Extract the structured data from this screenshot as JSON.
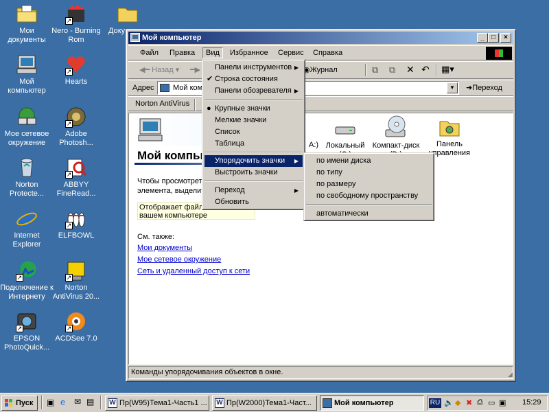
{
  "desktop": {
    "icons": [
      {
        "label": "Мои документы",
        "icon": "folder-documents-icon"
      },
      {
        "label": "Nero - Burning Rom",
        "icon": "nero-icon"
      },
      {
        "label": "Доку",
        "icon": "folder-icon"
      },
      {
        "label": "Мой компьютер",
        "icon": "my-computer-icon"
      },
      {
        "label": "Hearts",
        "icon": "hearts-icon"
      },
      {
        "label": "Мое сетевое окружение",
        "icon": "network-icon"
      },
      {
        "label": "Adobe Photosh...",
        "icon": "photoshop-icon"
      },
      {
        "label": "Norton Protecte...",
        "icon": "recycle-bin-icon"
      },
      {
        "label": "ABBYY FineRead...",
        "icon": "finereader-icon"
      },
      {
        "label": "Internet Explorer",
        "icon": "ie-icon"
      },
      {
        "label": "ELFBOWL",
        "icon": "elfbowl-icon"
      },
      {
        "label": "Подключение к Интернету",
        "icon": "connect-internet-icon"
      },
      {
        "label": "Norton AntiVirus 20...",
        "icon": "norton-icon"
      },
      {
        "label": "EPSON PhotoQuick...",
        "icon": "epson-icon"
      },
      {
        "label": "ACDSee 7.0",
        "icon": "acdsee-icon"
      }
    ]
  },
  "window": {
    "title": "Мой компьютер",
    "buttons": {
      "minimize": "_",
      "maximize": "□",
      "close": "×"
    },
    "menubar": [
      "Файл",
      "Правка",
      "Вид",
      "Избранное",
      "Сервис",
      "Справка"
    ],
    "toolbar": {
      "back": "Назад",
      "journal": "Журнал"
    },
    "address": {
      "label": "Адрес",
      "value": "Мой компьютер",
      "go": "Переход"
    },
    "links": {
      "norton": "Norton AntiVirus"
    },
    "content": {
      "heading": "Мой компьютер",
      "text1": "Чтобы просмотреть содержимое",
      "text2": "элемента, выделите его",
      "info1": "Отображает файлы и папки на",
      "info2": "вашем компьютере",
      "see_also": "См. также:",
      "links": [
        "Мои документы",
        "Мое сетевое окружение",
        "Сеть и удаленный доступ к сети"
      ],
      "drives": [
        {
          "label": "A:)",
          "icon": "floppy-icon"
        },
        {
          "label": "Локальный (C:)",
          "icon": "hard-drive-icon"
        },
        {
          "label": "Компакт-диск (D:)",
          "icon": "cd-drive-icon"
        },
        {
          "label": "Панель управления",
          "icon": "control-panel-icon"
        }
      ]
    },
    "status": "Команды упорядочивания объектов в окне."
  },
  "view_menu": {
    "items": [
      "Панели инструментов",
      "Строка состояния",
      "Панели обозревателя",
      "Крупные значки",
      "Мелкие значки",
      "Список",
      "Таблица",
      "Упорядочить значки",
      "Выстроить значки",
      "Переход",
      "Обновить"
    ]
  },
  "arrange_submenu": {
    "items": [
      "по имени диска",
      "по типу",
      "по размеру",
      "по свободному пространству",
      "автоматически"
    ]
  },
  "taskbar": {
    "start": "Пуск",
    "tasks": [
      "Пр(W95)Тема1-Часть1 ...",
      "Пр(W2000)Тема1-Част...",
      "Мой компьютер"
    ],
    "lang": "RU",
    "clock": "15:29"
  }
}
